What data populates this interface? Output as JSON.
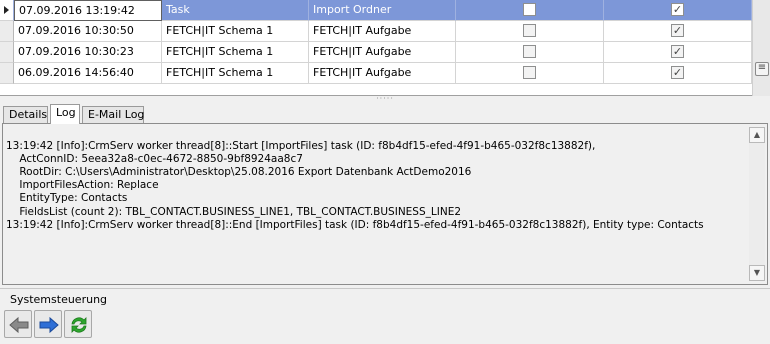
{
  "grid": {
    "rows": [
      {
        "date": "07.09.2016 13:19:42",
        "task": "Task",
        "action": "Import Ordner",
        "check1": false,
        "check2": true,
        "selected": true
      },
      {
        "date": "07.09.2016 10:30:50",
        "task": "FETCH|IT Schema 1",
        "action": "FETCH|IT Aufgabe",
        "check1": false,
        "check2": true,
        "selected": false
      },
      {
        "date": "07.09.2016 10:30:23",
        "task": "FETCH|IT Schema 1",
        "action": "FETCH|IT Aufgabe",
        "check1": false,
        "check2": true,
        "selected": false
      },
      {
        "date": "06.09.2016 14:56:40",
        "task": "FETCH|IT Schema 1",
        "action": "FETCH|IT Aufgabe",
        "check1": false,
        "check2": true,
        "selected": false
      }
    ]
  },
  "tabs": [
    "Details",
    "Log",
    "E-Mail Log"
  ],
  "active_tab": "Log",
  "log": {
    "lines": [
      "13:19:42 [Info]:CrmServ worker thread[8]::Start [ImportFiles] task (ID: f8b4df15-efed-4f91-b465-032f8c13882f),",
      "    ActConnID: 5eea32a8-c0ec-4672-8850-9bf8924aa8c7",
      "    RootDir: C:\\Users\\Administrator\\Desktop\\25.08.2016 Export Datenbank ActDemo2016",
      "    ImportFilesAction: Replace",
      "    EntityType: Contacts",
      "    FieldsList (count 2): TBL_CONTACT.BUSINESS_LINE1, TBL_CONTACT.BUSINESS_LINE2",
      "13:19:42 [Info]:CrmServ worker thread[8]::End [ImportFiles] task (ID: f8b4df15-efed-4f91-b465-032f8c13882f), Entity type: Contacts"
    ]
  },
  "system_control": {
    "label": "Systemsteuerung",
    "buttons": [
      {
        "icon": "back-arrow-icon",
        "color": "#8a8a8a"
      },
      {
        "icon": "forward-arrow-icon",
        "color": "#2f6fd6"
      },
      {
        "icon": "refresh-icon",
        "color": "#2ea62e"
      }
    ]
  }
}
